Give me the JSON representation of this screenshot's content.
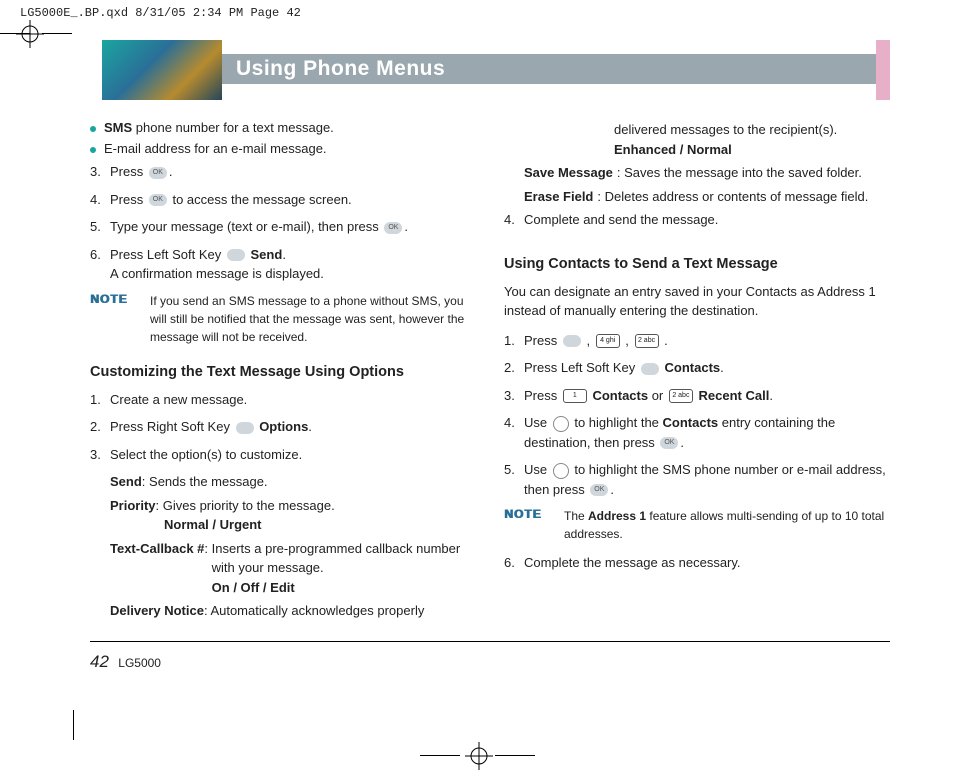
{
  "slug": "LG5000E_.BP.qxd  8/31/05  2:34 PM  Page 42",
  "header_title": "Using Phone Menus",
  "page_number": "42",
  "model": "LG5000",
  "left": {
    "bullet1_a": "SMS",
    "bullet1_b": " phone number for a text message.",
    "bullet2": "E-mail address for an e-mail message.",
    "step3": "Press ",
    "step3_end": ".",
    "step4_a": "Press ",
    "step4_b": " to access the message screen.",
    "step5_a": "Type your message (text or e-mail), then press ",
    "step5_b": ".",
    "step6_a": "Press Left Soft Key ",
    "step6_b": "Send",
    "step6_c": ".",
    "step6_d": "A confirmation message is displayed.",
    "note_label": "NOTE",
    "note1": "If you send an SMS message to a phone without SMS, you will still be notified that the message was sent, however the message will not be received.",
    "subhead1": "Customizing the Text Message Using Options",
    "c1": "Create a new message.",
    "c2_a": "Press Right Soft Key ",
    "c2_b": "Options",
    "c2_c": ".",
    "c3": "Select the option(s) to customize.",
    "opt_send_t": "Send",
    "opt_send_d": ": Sends the message.",
    "opt_pri_t": "Priority",
    "opt_pri_d": ": Gives priority to the message.",
    "opt_pri_v": "Normal / Urgent",
    "opt_cb_t": "Text-Callback #",
    "opt_cb_d": ": Inserts a pre-programmed callback number with your message.",
    "opt_cb_v": "On / Off / Edit",
    "opt_dn_t": "Delivery Notice",
    "opt_dn_d": ": Automatically acknowledges properly"
  },
  "right": {
    "cont1": "delivered messages to the recipient(s).",
    "cont1_v": "Enhanced / Normal",
    "sm_t": "Save Message",
    "sm_d": ": Saves the message into the saved folder.",
    "ef_t": "Erase Field",
    "ef_d": ": Deletes address or contents of message field.",
    "step4r": "Complete and send the message.",
    "subhead2": "Using Contacts to Send a Text Message",
    "intro2": "You can designate an entry saved in your Contacts as Address 1 instead of manually entering the destination.",
    "r1_a": "Press ",
    "r1_b": " , ",
    "r1_c": " , ",
    "r1_d": " .",
    "r2_a": "Press Left Soft Key ",
    "r2_b": "Contacts",
    "r2_c": ".",
    "r3_a": "Press ",
    "r3_b": "Contacts",
    "r3_c": " or ",
    "r3_d": "Recent Call",
    "r3_e": ".",
    "r4_a": "Use ",
    "r4_b": " to highlight the ",
    "r4_c": "Contacts",
    "r4_d": " entry containing the destination, then press ",
    "r4_e": ".",
    "r5_a": "Use ",
    "r5_b": " to highlight the SMS phone number or e-mail address, then press ",
    "r5_c": ".",
    "note2_a": "The ",
    "note2_b": "Address 1",
    "note2_c": " feature allows multi-sending of up to 10 total addresses.",
    "r6": "Complete the message as necessary.",
    "key_4": "4 ghi",
    "key_2": "2 abc",
    "key_1": "1",
    "ok_label": "OK"
  }
}
